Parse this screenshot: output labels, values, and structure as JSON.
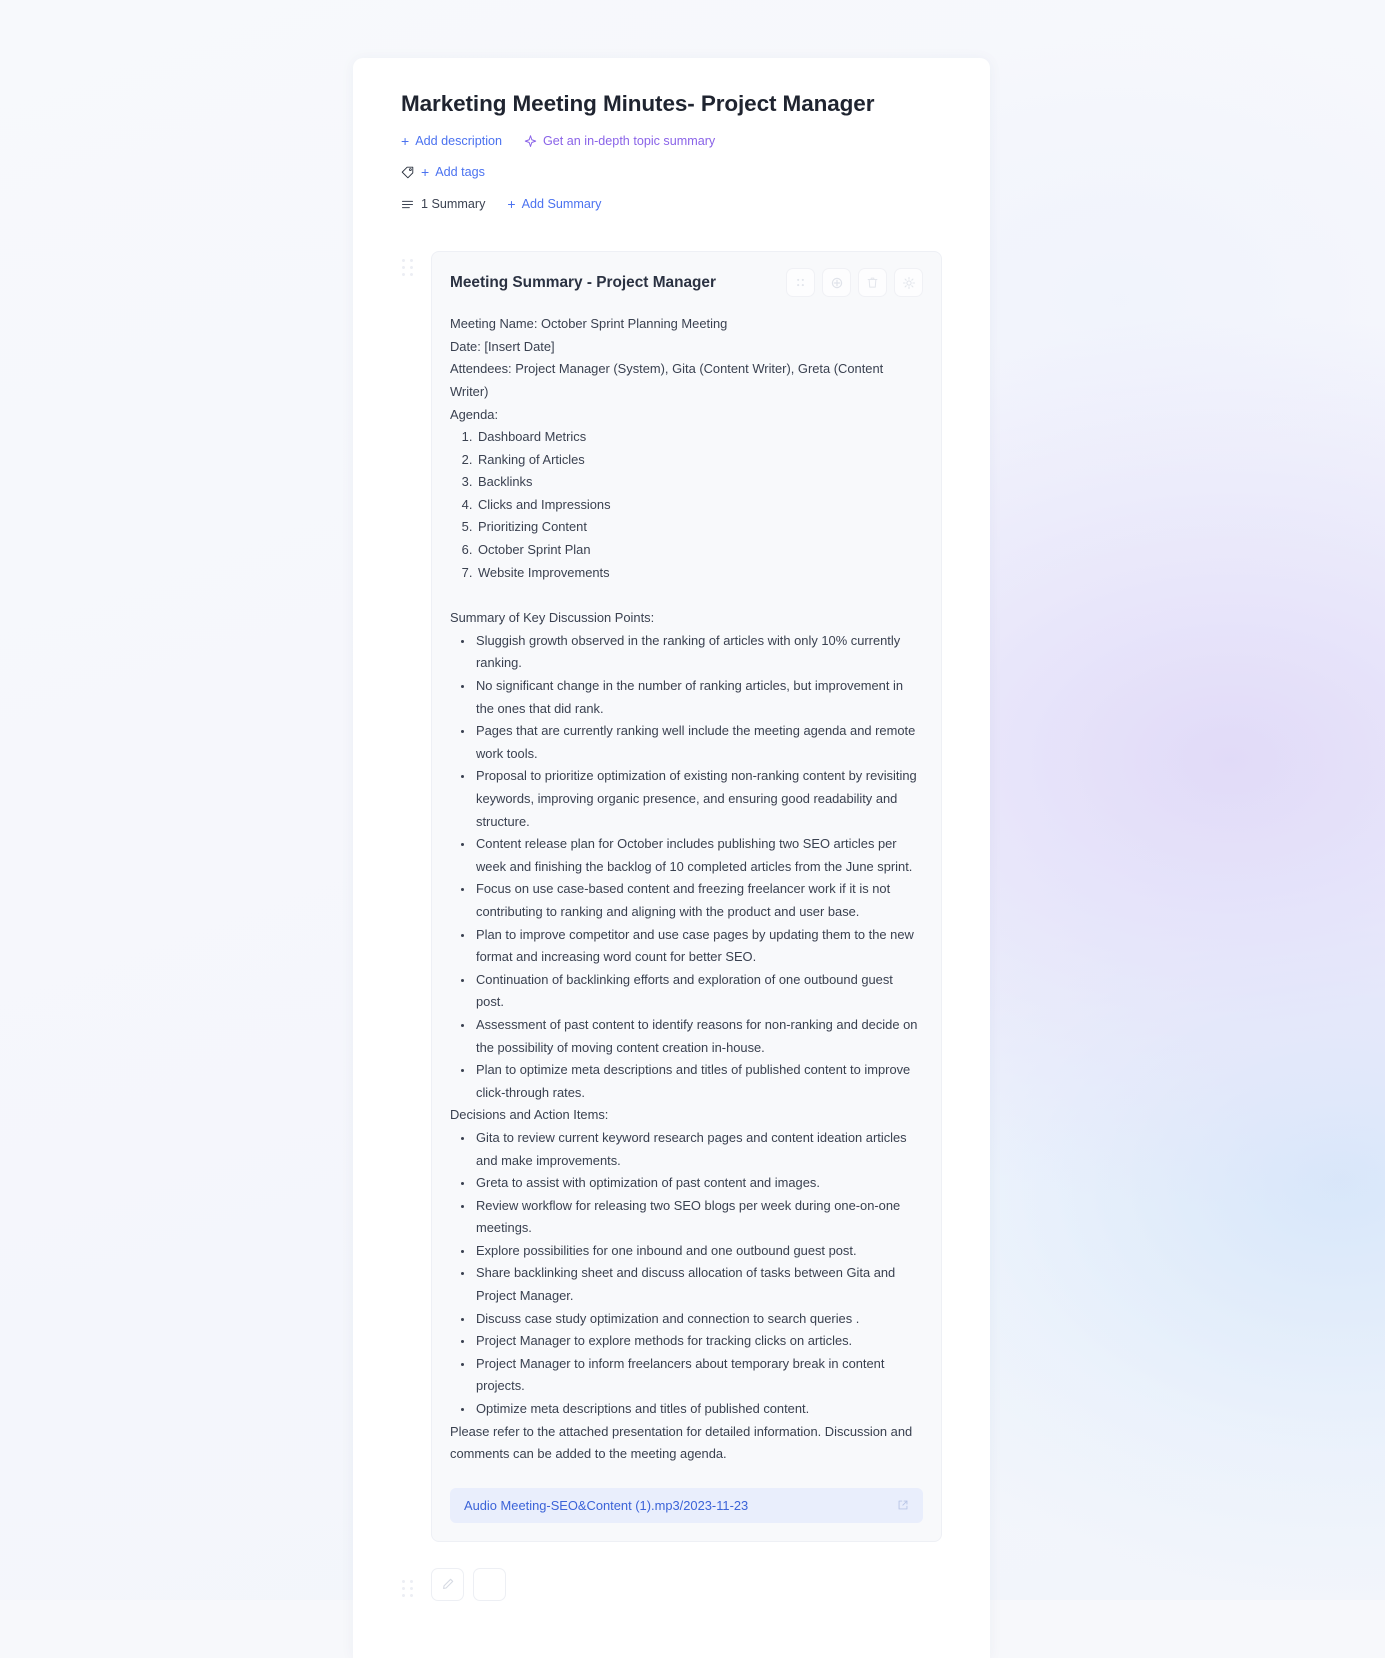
{
  "document": {
    "title": "Marketing Meeting Minutes- Project Manager",
    "add_description_label": "Add description",
    "topic_summary_label": "Get an in-depth topic summary",
    "add_tags_label": "Add tags",
    "summary_count_label": "1 Summary",
    "add_summary_label": "Add Summary"
  },
  "summary_card": {
    "title": "Meeting Summary - Project Manager",
    "actions": [
      {
        "name": "drag-grid-icon",
        "label": ""
      },
      {
        "name": "add-circle-icon",
        "label": ""
      },
      {
        "name": "trash-icon",
        "label": ""
      },
      {
        "name": "settings-icon",
        "label": ""
      }
    ],
    "meeting_name": "Meeting Name: October Sprint Planning Meeting",
    "date": "Date: [Insert Date]",
    "attendees": "Attendees: Project Manager (System), Gita (Content Writer), Greta (Content Writer)",
    "agenda_heading": "Agenda:",
    "agenda": [
      "Dashboard Metrics",
      "Ranking of Articles",
      "Backlinks",
      "Clicks and Impressions",
      "Prioritizing Content",
      "October Sprint Plan",
      "Website Improvements"
    ],
    "discussion_heading": "Summary of Key Discussion Points:",
    "discussion_points": [
      "Sluggish growth observed in the ranking of articles with only 10% currently ranking.",
      "No significant change in the number of ranking articles, but improvement in the ones that did rank.",
      "Pages that are currently ranking well include the meeting agenda and remote work tools.",
      "Proposal to prioritize optimization of existing non-ranking content by revisiting keywords, improving organic presence, and ensuring good readability and structure.",
      "Content release plan for October includes publishing two SEO articles per week and finishing the backlog of 10 completed articles from the June sprint.",
      "Focus on use case-based content and freezing freelancer work if it is not contributing to ranking and aligning with the product and user base.",
      "Plan to improve competitor and use case pages by updating them to the new format and increasing word count for better SEO.",
      "Continuation of backlinking efforts and exploration of one outbound guest post.",
      "Assessment of past content to identify reasons for non-ranking and decide on the possibility of moving content creation in-house.",
      "Plan to optimize meta descriptions and titles of published content to improve click-through rates."
    ],
    "decisions_heading": "Decisions and Action Items:",
    "decisions": [
      "Gita to review current keyword research pages and content ideation articles and make improvements.",
      "Greta to assist with optimization of past content and images.",
      "Review workflow for releasing two SEO blogs per week during one-on-one meetings.",
      "Explore possibilities for one inbound and one outbound guest post.",
      "Share backlinking sheet and discuss allocation of tasks between Gita and Project Manager.",
      "Discuss case study optimization and connection to search queries .",
      "Project Manager to explore methods for tracking clicks on articles.",
      "Project Manager to inform freelancers about temporary break in content projects.",
      "Optimize meta descriptions and titles of published content."
    ],
    "closing_note": "Please refer to the attached presentation for detailed information. Discussion and comments can be added to the meeting agenda.",
    "attachment_label": "Audio Meeting-SEO&Content (1).mp3/2023-11-23"
  },
  "colors": {
    "link_blue": "#4b72f0",
    "accent_purple": "#8a63e8",
    "attachment_bg": "#e9eefc",
    "attachment_text": "#3b63d8",
    "card_bg": "#f8f9fb",
    "text_primary": "#1f2430",
    "text_body": "#3a4150"
  }
}
